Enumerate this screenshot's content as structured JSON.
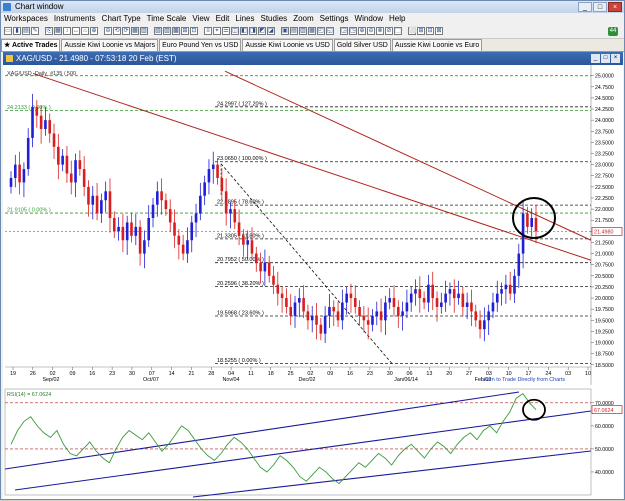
{
  "app": {
    "window_title": "Chart window",
    "menu": [
      "Workspaces",
      "Instruments",
      "Chart Type",
      "Time Scale",
      "View",
      "Edit",
      "Lines",
      "Studies",
      "Zoom",
      "Settings",
      "Window",
      "Help"
    ],
    "toolbar_badge": "44"
  },
  "tabs": [
    {
      "label": "★ Active Trades",
      "active": true
    },
    {
      "label": "Aussie Kiwi Loonie vs Majors",
      "active": false
    },
    {
      "label": "Euro Pound Yen vs USD",
      "active": false
    },
    {
      "label": "Aussie Kiwi Loonie vs USD",
      "active": false
    },
    {
      "label": "Gold Silver USD",
      "active": false
    },
    {
      "label": "Aussie Kiwi Loonie vs Euro",
      "active": false
    }
  ],
  "chart_window": {
    "title": "XAG/USD - 21.4980 - 07:53:18  20 Feb (EST)",
    "legend": "XAG/USD_Daily_#135 / 500",
    "learn_link": "Learn to Trade Directly from Charts",
    "current_price_box": "21.4980"
  },
  "chart_data": [
    {
      "type": "candlestick",
      "symbol": "XAG/USD",
      "timeframe": "Daily",
      "y_ticks": [
        "25.0000",
        "24.7500",
        "24.5000",
        "24.2500",
        "24.0000",
        "23.7500",
        "23.5000",
        "23.2500",
        "23.0000",
        "22.7500",
        "22.5000",
        "22.2500",
        "22.0000",
        "21.7500",
        "21.5000",
        "21.2500",
        "21.0000",
        "20.7500",
        "20.5000",
        "20.2500",
        "20.0000",
        "19.7500",
        "19.5000",
        "19.2500",
        "19.0000",
        "18.7500",
        "18.5000"
      ],
      "ylim": [
        18.45,
        25.15
      ],
      "x_tick_labels": [
        "19",
        "26",
        "02",
        "09",
        "16",
        "23",
        "30",
        "07",
        "14",
        "21",
        "28",
        "04",
        "11",
        "18",
        "25",
        "02",
        "09",
        "16",
        "23",
        "30",
        "06",
        "13",
        "20",
        "27",
        "03",
        "10",
        "17",
        "24",
        "03",
        "10"
      ],
      "x_month_labels": [
        "Sep/02",
        "Oct/07",
        "Nov/04",
        "Dec/02",
        "Jan/06/14",
        "Feb/03"
      ],
      "fibonacci_levels": [
        {
          "label": "24.2997 ( 127.20% )",
          "value": 24.2997
        },
        {
          "label": "23.0650 ( 100.00% )",
          "value": 23.065
        },
        {
          "label": "22.0895 ( 78.60% )",
          "value": 22.0895
        },
        {
          "label": "21.3305 ( 61.80% )",
          "value": 21.3305
        },
        {
          "label": "20.7952 ( 50.00% )",
          "value": 20.7952
        },
        {
          "label": "20.2596 ( 38.20% )",
          "value": 20.2596
        },
        {
          "label": "19.5968 ( 23.60% )",
          "value": 19.5968
        },
        {
          "label": "18.5255 ( 0.00% )",
          "value": 18.5255
        }
      ],
      "green_levels": [
        {
          "label": "24.2133 ( 0.00% )",
          "value": 24.2133
        },
        {
          "label": "21.9105 ( 0.00% )",
          "value": 21.9105
        }
      ],
      "top_dashed_level": 25.0,
      "current_price": 21.498,
      "up_color": "#1f1fd6",
      "down_color": "#d81f1f",
      "trendline_color": "#b0261e"
    },
    {
      "type": "line",
      "indicator_label": "RSI(14) = 67.0624",
      "series": [
        {
          "name": "RSI(14)",
          "color": "#3a9a3a"
        }
      ],
      "current_value_box": "67.0624",
      "y_ticks": [
        "70.0000",
        "60.0000",
        "50.0000",
        "40.0000"
      ],
      "ylim": [
        30,
        76
      ],
      "levels": [
        {
          "value": 70,
          "color": "#b22020"
        },
        {
          "value": 50,
          "color": "#b22020"
        }
      ],
      "channel_color": "#1a1a9a"
    }
  ]
}
